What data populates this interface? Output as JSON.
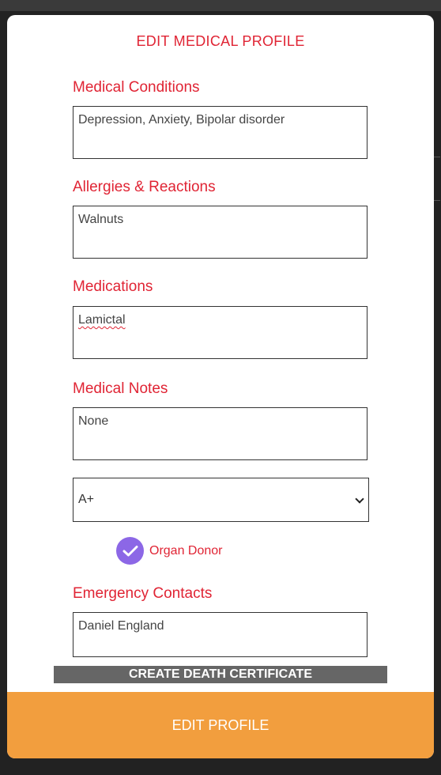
{
  "modal": {
    "title": "EDIT MEDICAL PROFILE"
  },
  "fields": {
    "conditions": {
      "label": "Medical Conditions",
      "value": "Depression, Anxiety, Bipolar disorder"
    },
    "allergies": {
      "label": "Allergies & Reactions",
      "value": "Walnuts"
    },
    "medications": {
      "label": "Medications",
      "value": "Lamictal"
    },
    "notes": {
      "label": "Medical Notes",
      "value": "None"
    },
    "emergency": {
      "label": "Emergency Contacts",
      "value": "Daniel England"
    }
  },
  "blood_type": {
    "selected": "A+",
    "icon": "chevron-down-icon"
  },
  "organ_donor": {
    "label": "Organ Donor",
    "checked": true,
    "icon": "check-icon",
    "color": "#8c67e6"
  },
  "actions": {
    "death_certificate_label": "CREATE DEATH CERTIFICATE",
    "edit_profile_label": "EDIT PROFILE"
  },
  "colors": {
    "accent_red": "#e02434",
    "primary_button": "#f29e3e",
    "secondary_button": "#666666"
  }
}
